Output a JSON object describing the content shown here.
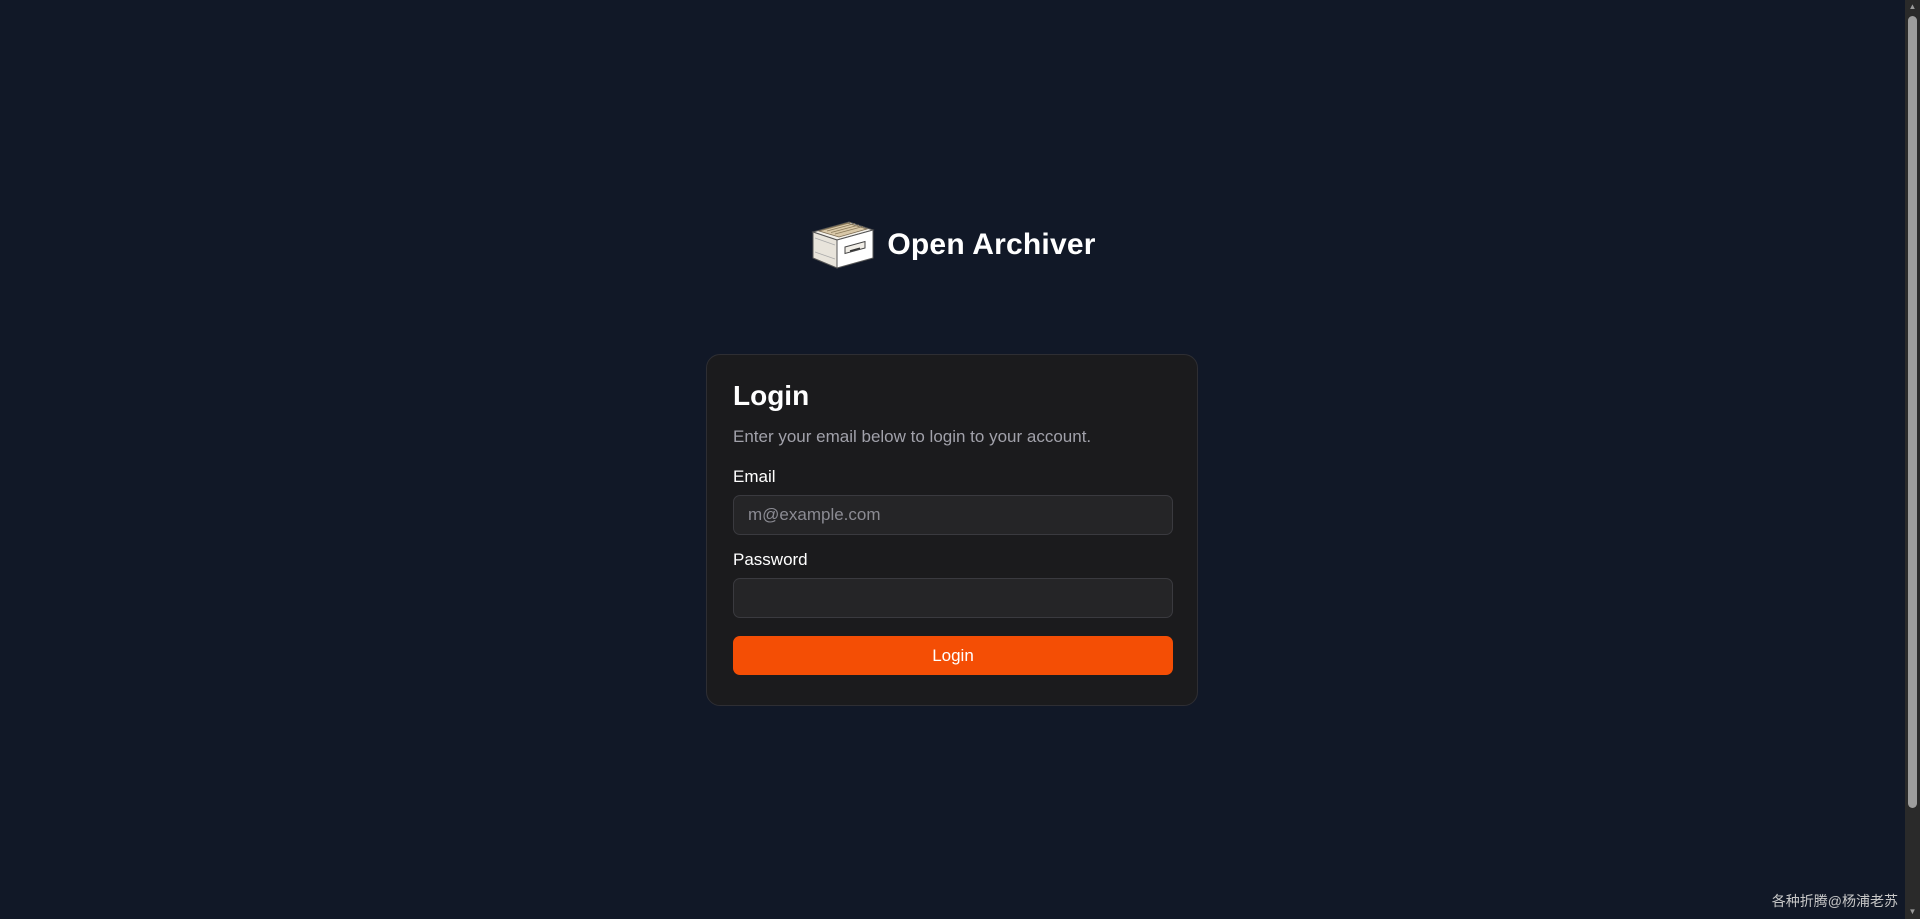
{
  "brand": {
    "logo_icon": "file-drawer-icon",
    "name": "Open Archiver"
  },
  "login_card": {
    "title": "Login",
    "description": "Enter your email below to login to your account.",
    "email_label": "Email",
    "email_placeholder": "m@example.com",
    "email_value": "",
    "password_label": "Password",
    "password_value": "",
    "submit_label": "Login"
  },
  "colors": {
    "background": "#111827",
    "card": "#1b1b1d",
    "accent": "#f44e05"
  },
  "watermark": "各种折腾@杨浦老苏"
}
